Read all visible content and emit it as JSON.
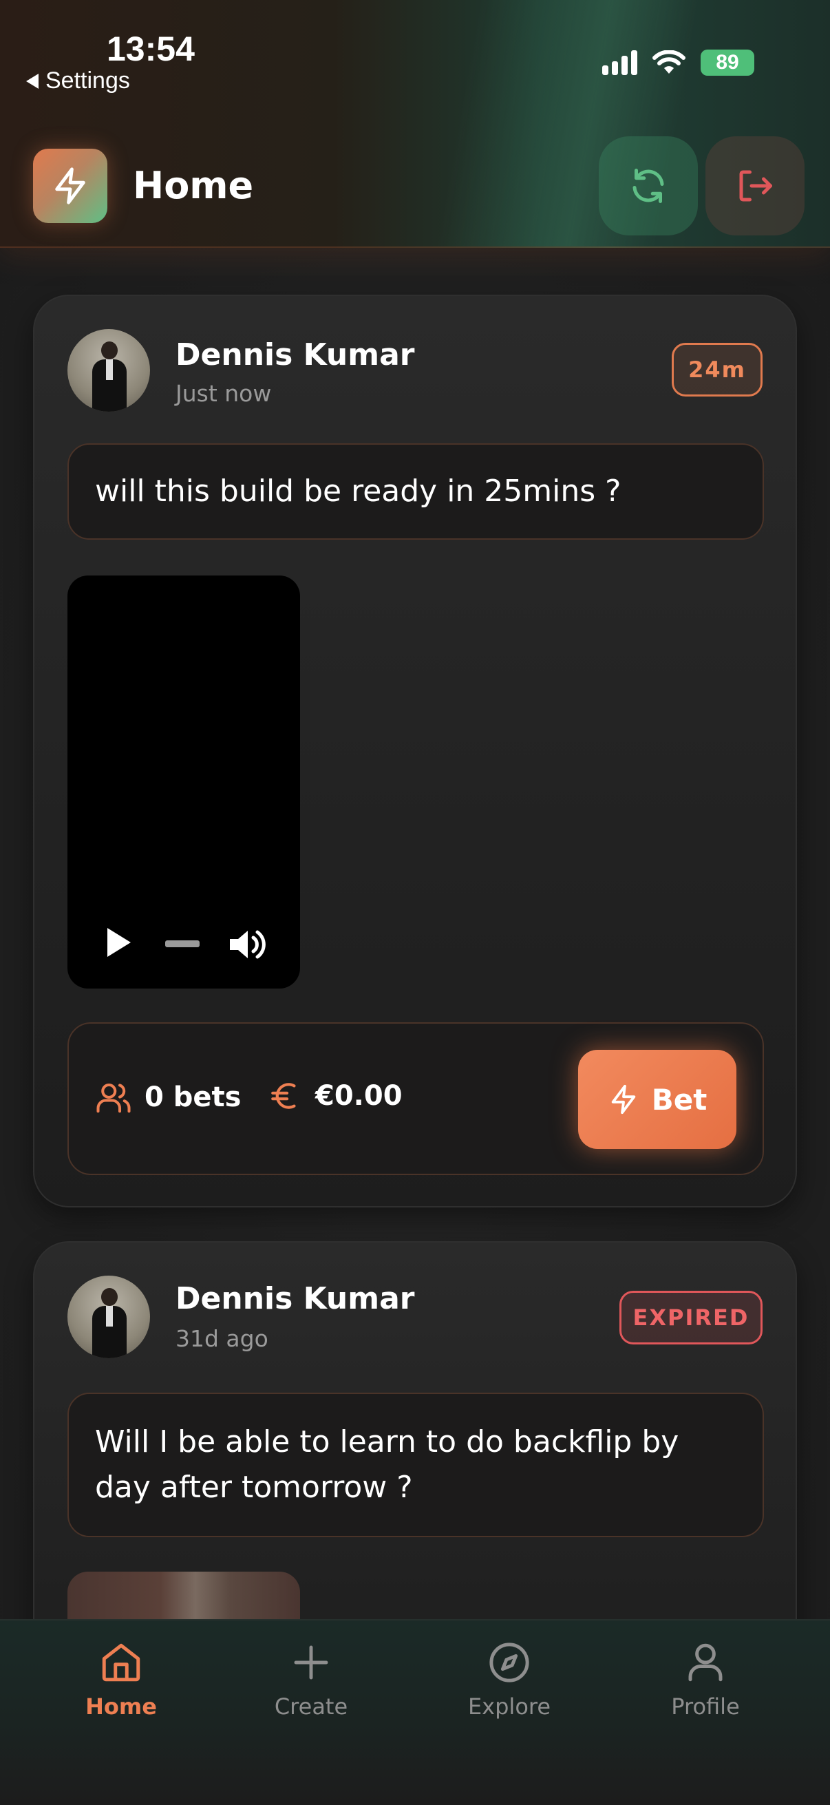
{
  "status_bar": {
    "time": "13:54",
    "back_label": "Settings",
    "battery": "89"
  },
  "header": {
    "title": "Home",
    "logo_icon": "lightning-icon",
    "refresh_icon": "refresh-icon",
    "logout_icon": "logout-icon"
  },
  "posts": [
    {
      "author": "Dennis Kumar",
      "time_ago": "Just now",
      "badge": "24m",
      "question": "will this build be ready in 25mins ?",
      "bets_count": "0 bets",
      "amount": "€0.00",
      "bet_button": "Bet"
    },
    {
      "author": "Dennis Kumar",
      "time_ago": "31d ago",
      "badge": "EXPIRED",
      "question": "Will I be able to learn to do backflip by day after tomorrow ?"
    }
  ],
  "nav": {
    "home": "Home",
    "create": "Create",
    "explore": "Explore",
    "profile": "Profile"
  },
  "colors": {
    "accent": "#EE7F52",
    "success": "#5FBF86",
    "danger": "#E0575A"
  }
}
